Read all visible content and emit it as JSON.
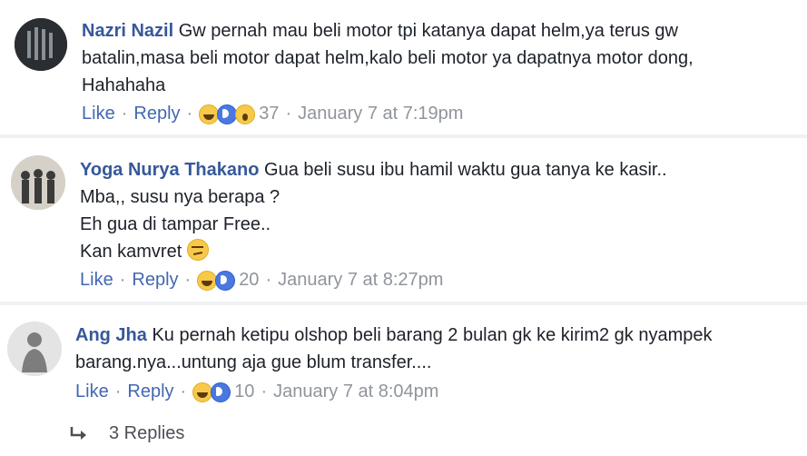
{
  "comments": [
    {
      "name": "Nazri Nazil",
      "lines": [
        "Gw pernah mau beli motor tpi katanya dapat helm,ya terus gw",
        "batalin,masa beli motor dapat helm,kalo beli motor ya dapatnya motor dong,",
        "Hahahaha"
      ],
      "like_label": "Like",
      "reply_label": "Reply",
      "reaction_count": "37",
      "timestamp": "January 7 at 7:19pm",
      "reactions": [
        "haha-icon",
        "like-icon",
        "wow-icon"
      ]
    },
    {
      "name": "Yoga Nurya Thakano",
      "lines": [
        "Gua beli susu ibu hamil waktu gua tanya ke kasir..",
        "Mba,, susu nya berapa ?",
        "Eh gua di tampar Free..",
        "Kan kamvret"
      ],
      "like_label": "Like",
      "reply_label": "Reply",
      "reaction_count": "20",
      "timestamp": "January 7 at 8:27pm",
      "reactions": [
        "haha-icon",
        "like-icon"
      ]
    },
    {
      "name": "Ang Jha",
      "lines": [
        "Ku pernah ketipu olshop beli barang 2 bulan gk ke kirim2 gk nyampek",
        "barang.nya...untung aja gue blum transfer...."
      ],
      "like_label": "Like",
      "reply_label": "Reply",
      "reaction_count": "10",
      "timestamp": "January 7 at 8:04pm",
      "reactions": [
        "haha-icon",
        "like-icon"
      ]
    }
  ],
  "replies_link": {
    "label": "3 Replies",
    "icon": "reply-arrow-icon"
  },
  "separator": "·"
}
